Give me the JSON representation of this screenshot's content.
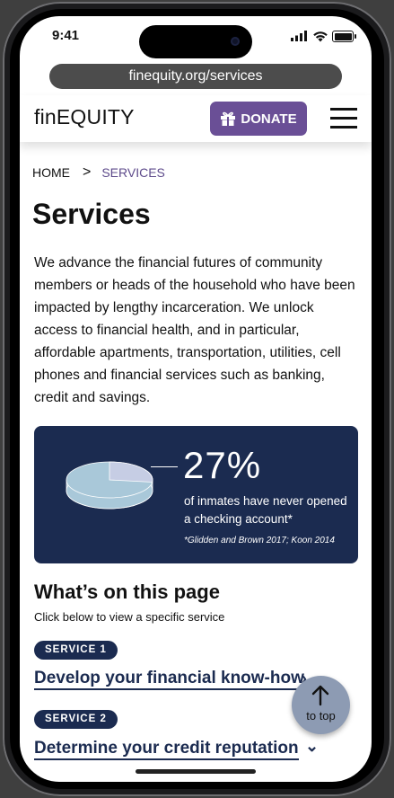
{
  "status_bar": {
    "time": "9:41"
  },
  "browser": {
    "url": "finequity.org/services"
  },
  "header": {
    "logo": "finEQUITY",
    "donate_label": "DONATE"
  },
  "breadcrumb": {
    "home": "HOME",
    "separator": ">",
    "current": "SERVICES"
  },
  "page": {
    "title": "Services",
    "intro": "We advance the financial futures of community members or heads of the household who have been impacted by lengthy incarceration. We unlock access to financial health, and in particular, affordable apartments, transportation, utilities, cell phones and financial services such as banking, credit and savings."
  },
  "stat": {
    "percent": "27%",
    "percent_value": 27,
    "text": "of inmates have never opened a checking account*",
    "source": "*Glidden and Brown 2017; Koon 2014"
  },
  "toc": {
    "title": "What’s on this page",
    "subtitle": "Click below to view a specific service",
    "services": [
      {
        "badge": "SERVICE 1",
        "label": "Develop your financial know-how"
      },
      {
        "badge": "SERVICE 2",
        "label": "Determine your credit reputation"
      }
    ]
  },
  "to_top": {
    "label": "to top"
  },
  "colors": {
    "accent": "#6a4f96",
    "navy": "#1b2b50",
    "pie_main": "#a9c8d9",
    "pie_slice": "#c6cde4"
  },
  "icons": [
    "gift-icon",
    "menu-icon",
    "chevron-right-icon",
    "chevron-down-icon",
    "arrow-up-icon",
    "signal-icon",
    "wifi-icon",
    "battery-icon"
  ]
}
